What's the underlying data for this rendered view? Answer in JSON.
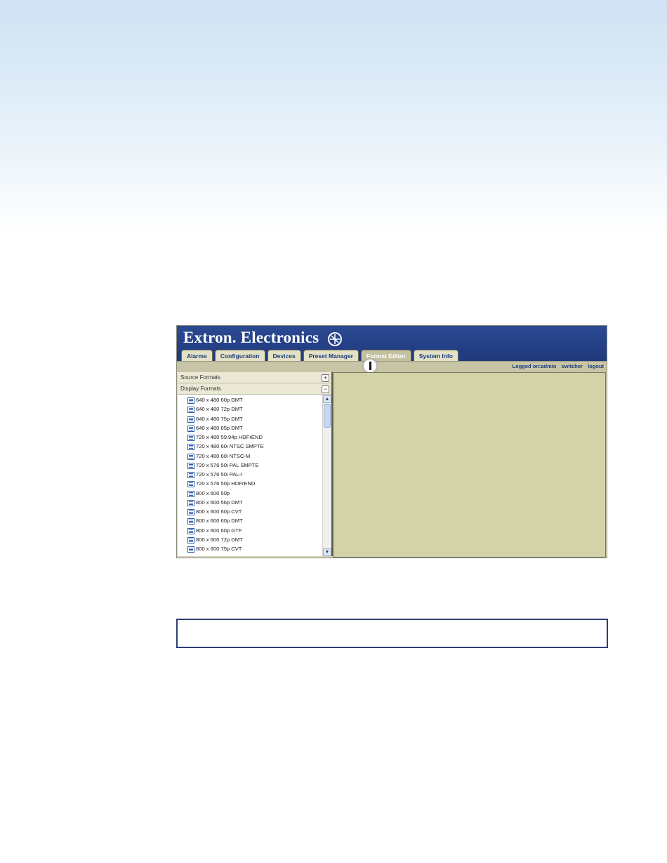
{
  "app": {
    "logo_text": "Extron. Electronics",
    "tabs": [
      {
        "label": "Alarms",
        "active": false
      },
      {
        "label": "Configuration",
        "active": false
      },
      {
        "label": "Devices",
        "active": false
      },
      {
        "label": "Preset Manager",
        "active": false
      },
      {
        "label": "Format Editor",
        "active": true
      },
      {
        "label": "System Info",
        "active": false
      }
    ],
    "user_links": {
      "logged_on": "Logged on:admin",
      "switcher": "switcher",
      "logout": "logout"
    }
  },
  "left_panel": {
    "source_formats": {
      "label": "Source Formats",
      "toggle": "+"
    },
    "display_formats": {
      "label": "Display Formats",
      "toggle": "−"
    },
    "items": [
      "640 x 480 60p DMT",
      "640 x 480 72p DMT",
      "640 x 480 75p DMT",
      "640 x 480 85p DMT",
      "720 x 480 59.94p HDFrEND",
      "720 x 480 60i NTSC SMPTE",
      "720 x 480 60i NTSC-M",
      "720 x 576 50i PAL SMPTE",
      "720 x 576 50i PAL-I",
      "720 x 576 50p HDFrEND",
      "800 x 600 50p",
      "800 x 600 56p DMT",
      "800 x 600 60p CVT",
      "800 x 600 60p DMT",
      "800 x 600 60p GTF",
      "800 x 600 72p DMT",
      "800 x 600 75p CVT"
    ]
  },
  "colors": {
    "banner": "#233f86",
    "tab_text": "#1e3d7a",
    "panel_bg": "#d3d2a9",
    "note_border": "#2e3f72"
  }
}
